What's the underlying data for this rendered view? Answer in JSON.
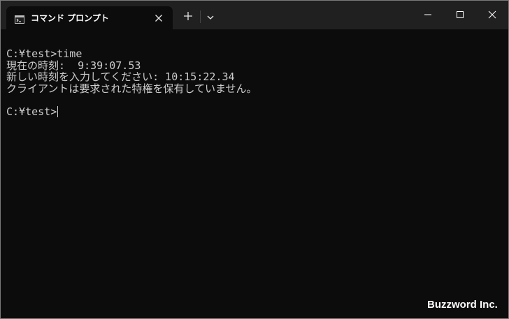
{
  "window": {
    "tab_title": "コマンド プロンプト"
  },
  "icons": {
    "tab": "command-prompt-icon",
    "close": "close-icon",
    "new_tab": "plus-icon",
    "dropdown": "chevron-down-icon",
    "minimize": "minimize-icon",
    "maximize": "maximize-icon",
    "close_window": "close-icon"
  },
  "terminal": {
    "lines": [
      "",
      "C:¥test>time",
      "現在の時刻:  9:39:07.53",
      "新しい時刻を入力してください: 10:15:22.34",
      "クライアントは要求された特権を保有していません。",
      "",
      "C:¥test>"
    ]
  },
  "watermark": "Buzzword Inc.",
  "colors": {
    "titlebar": "#202020",
    "terminal_bg": "#0c0c0c",
    "terminal_text": "#cccccc"
  }
}
